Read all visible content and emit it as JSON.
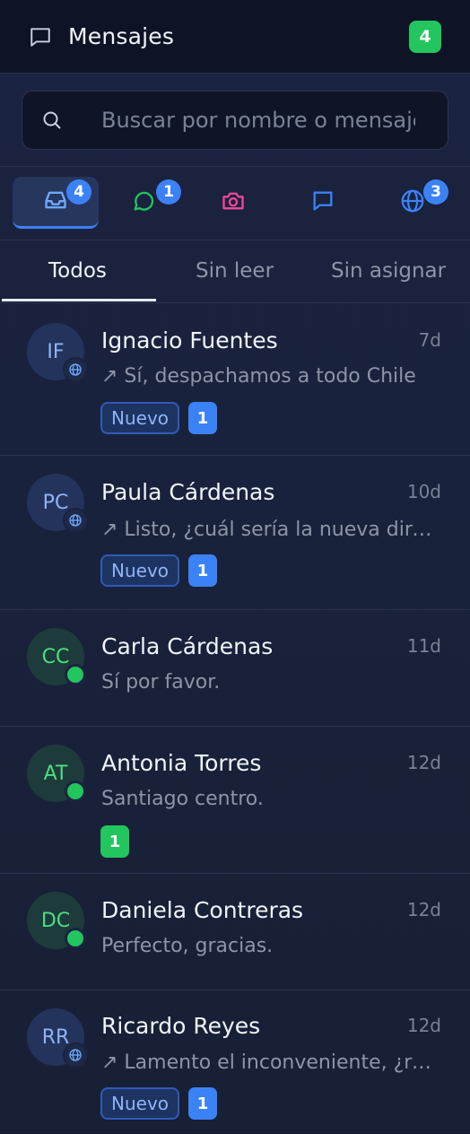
{
  "header": {
    "title": "Mensajes",
    "count": "4",
    "icon": "chat-bubble-icon"
  },
  "search": {
    "placeholder": "Buscar por nombre o mensaje"
  },
  "channels": [
    {
      "name": "inbox",
      "icon": "inbox-icon",
      "badge": "4",
      "color": "#6ea8ff",
      "active": true
    },
    {
      "name": "whatsapp",
      "icon": "whatsapp-icon",
      "badge": "1",
      "color": "#22c55e",
      "active": false
    },
    {
      "name": "instagram",
      "icon": "camera-icon",
      "badge": "",
      "color": "#ec4899",
      "active": false
    },
    {
      "name": "messenger",
      "icon": "message-square-icon",
      "badge": "",
      "color": "#3b82f6",
      "active": false
    },
    {
      "name": "web",
      "icon": "globe-icon",
      "badge": "3",
      "color": "#3b82f6",
      "active": false
    }
  ],
  "tabs": [
    {
      "label": "Todos",
      "active": true
    },
    {
      "label": "Sin leer",
      "active": false
    },
    {
      "label": "Sin asignar",
      "active": false
    }
  ],
  "conversations": [
    {
      "initials": "IF",
      "name": "Ignacio Fuentes",
      "time": "7d",
      "preview": "↗ Sí, despachamos a todo Chile",
      "tag": "Nuevo",
      "unread": "1",
      "channel": "web"
    },
    {
      "initials": "PC",
      "name": "Paula Cárdenas",
      "time": "10d",
      "preview": "↗ Listo, ¿cuál sería la nueva dirección?",
      "tag": "Nuevo",
      "unread": "1",
      "channel": "web"
    },
    {
      "initials": "CC",
      "name": "Carla Cárdenas",
      "time": "11d",
      "preview": "Sí por favor.",
      "tag": "",
      "unread": "",
      "channel": "whatsapp"
    },
    {
      "initials": "AT",
      "name": "Antonia Torres",
      "time": "12d",
      "preview": "Santiago centro.",
      "tag": "",
      "unread": "1",
      "channel": "whatsapp"
    },
    {
      "initials": "DC",
      "name": "Daniela Contreras",
      "time": "12d",
      "preview": "Perfecto, gracias.",
      "tag": "",
      "unread": "",
      "channel": "whatsapp"
    },
    {
      "initials": "RR",
      "name": "Ricardo Reyes",
      "time": "12d",
      "preview": "↗ Lamento el inconveniente, ¿revisamos?",
      "tag": "Nuevo",
      "unread": "1",
      "channel": "web"
    }
  ]
}
